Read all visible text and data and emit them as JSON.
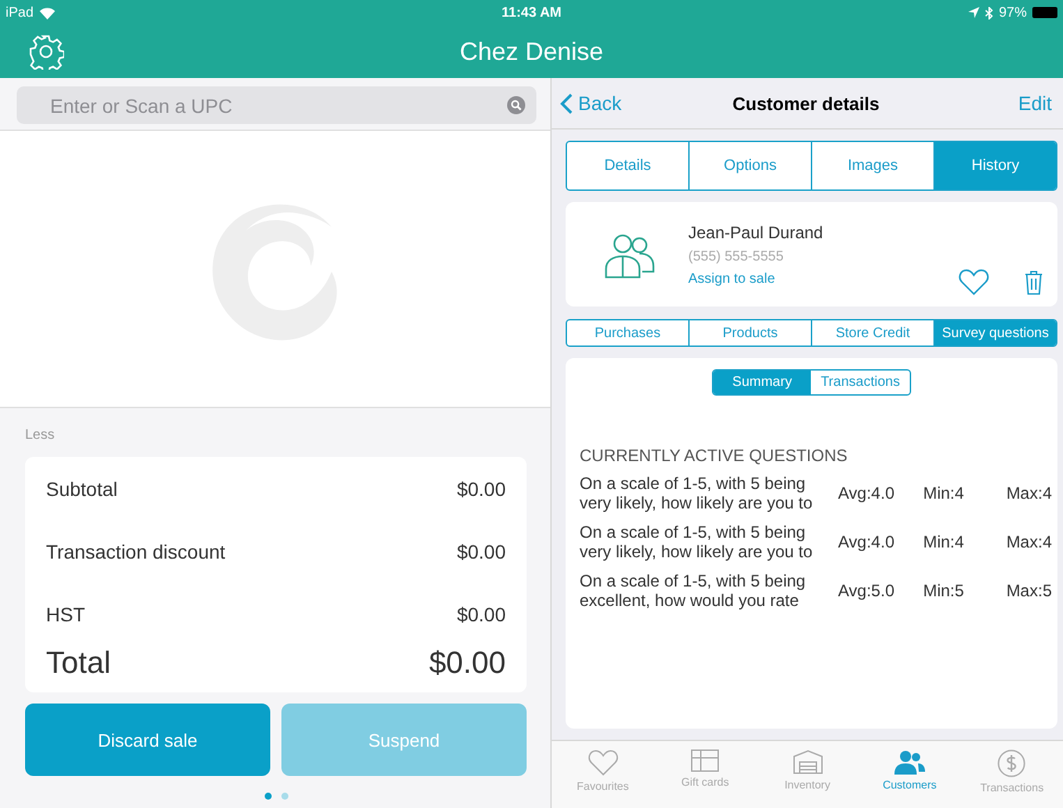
{
  "status_bar": {
    "device": "iPad",
    "time": "11:43 AM",
    "battery": "97%"
  },
  "nav": {
    "title": "Chez Denise"
  },
  "search": {
    "placeholder": "Enter or Scan a UPC"
  },
  "sale": {
    "section_label": "Less",
    "lines": [
      {
        "kind": "line",
        "label": "Subtotal",
        "amount": "$0.00"
      },
      {
        "kind": "line",
        "label": "Transaction discount",
        "amount": "$0.00"
      },
      {
        "kind": "line",
        "label": "HST",
        "amount": "$0.00"
      },
      {
        "kind": "total",
        "label": "Total",
        "amount": "$0.00"
      }
    ],
    "buttons": [
      {
        "label": "Discard sale",
        "disabled": false
      },
      {
        "label": "Suspend",
        "disabled": true
      }
    ],
    "pages": [
      {
        "selected": true
      },
      {
        "selected": false
      }
    ]
  },
  "detail_header": {
    "back": "Back",
    "title": "Customer details",
    "action": "Edit"
  },
  "tabs": [
    {
      "label": "Details",
      "selected": false
    },
    {
      "label": "Options",
      "selected": false
    },
    {
      "label": "Images",
      "selected": false
    },
    {
      "label": "History",
      "selected": true
    }
  ],
  "customer": {
    "name": "Jean-Paul Durand",
    "phone": "(555) 555-5555",
    "assign": "Assign to sale"
  },
  "history_tabs": [
    {
      "label": "Purchases",
      "selected": false
    },
    {
      "label": "Products",
      "selected": false
    },
    {
      "label": "Store Credit",
      "selected": false
    },
    {
      "label": "Survey questions",
      "selected": true
    }
  ],
  "view_toggle": [
    {
      "label": "Summary",
      "selected": true
    },
    {
      "label": "Transactions",
      "selected": false
    }
  ],
  "questions": {
    "heading": "CURRENTLY ACTIVE QUESTIONS",
    "rows": [
      {
        "question": "On a scale of 1-5, with 5 being very likely, how likely are you to",
        "avg": "Avg:4.0",
        "min": "Min:4",
        "max": "Max:4"
      },
      {
        "question": "On a scale of 1-5, with 5 being very likely, how likely are you to",
        "avg": "Avg:4.0",
        "min": "Min:4",
        "max": "Max:4"
      },
      {
        "question": "On a scale of 1-5, with 5 being excellent, how would you rate",
        "avg": "Avg:5.0",
        "min": "Min:5",
        "max": "Max:5"
      }
    ]
  },
  "tab_bar": [
    {
      "kind": "heart",
      "label": "Favourites",
      "selected": false
    },
    {
      "kind": "gift",
      "label": "Gift cards",
      "selected": false
    },
    {
      "kind": "warehouse",
      "label": "Inventory",
      "selected": false
    },
    {
      "kind": "people",
      "label": "Customers",
      "selected": true
    },
    {
      "kind": "dollar",
      "label": "Transactions",
      "selected": false
    }
  ]
}
